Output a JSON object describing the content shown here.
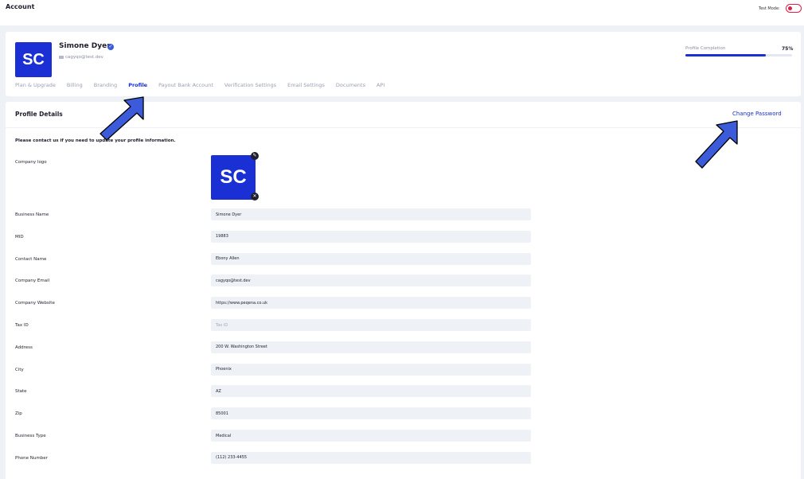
{
  "header": {
    "title": "Account",
    "test_mode_label": "Test Mode:"
  },
  "profile": {
    "initials": "SC",
    "name": "Simone Dyer",
    "email": "cagyqo@test.dev",
    "completion_label": "Profile Completion",
    "completion_value": "75%",
    "completion_fraction": 0.75
  },
  "tabs": [
    {
      "label": "Plan & Upgrade"
    },
    {
      "label": "Billing"
    },
    {
      "label": "Branding"
    },
    {
      "label": "Profile",
      "active": true
    },
    {
      "label": "Payout Bank Account"
    },
    {
      "label": "Verification Settings"
    },
    {
      "label": "Email Settings"
    },
    {
      "label": "Documents"
    },
    {
      "label": "API"
    }
  ],
  "details": {
    "title": "Profile Details",
    "change_password": "Change Password",
    "notice": "Please contact us if you need to update your profile information.",
    "logo_label": "Company logo",
    "logo_initials": "SC"
  },
  "fields": [
    {
      "label": "Business Name",
      "value": "Simone Dyer",
      "placeholder": ""
    },
    {
      "label": "MID",
      "value": "19883",
      "placeholder": ""
    },
    {
      "label": "Contact Name",
      "value": "Ebony Allen",
      "placeholder": ""
    },
    {
      "label": "Company Email",
      "value": "cagyqo@test.dev",
      "placeholder": ""
    },
    {
      "label": "Company Website",
      "value": "https://www.peqena.co.uk",
      "placeholder": ""
    },
    {
      "label": "Tax ID",
      "value": "",
      "placeholder": "Tax ID"
    },
    {
      "label": "Address",
      "value": "200 W. Washington Street",
      "placeholder": ""
    },
    {
      "label": "City",
      "value": "Phoenix",
      "placeholder": ""
    },
    {
      "label": "State",
      "value": "AZ",
      "placeholder": ""
    },
    {
      "label": "Zip",
      "value": "85001",
      "placeholder": ""
    },
    {
      "label": "Business Type",
      "value": "Medical",
      "placeholder": ""
    },
    {
      "label": "Phone Number",
      "value": "(112) 233-4455",
      "placeholder": ""
    }
  ],
  "colors": {
    "accent": "#1a2fd4",
    "arrow": "#3b5bdb",
    "toggle": "#e11d48"
  }
}
